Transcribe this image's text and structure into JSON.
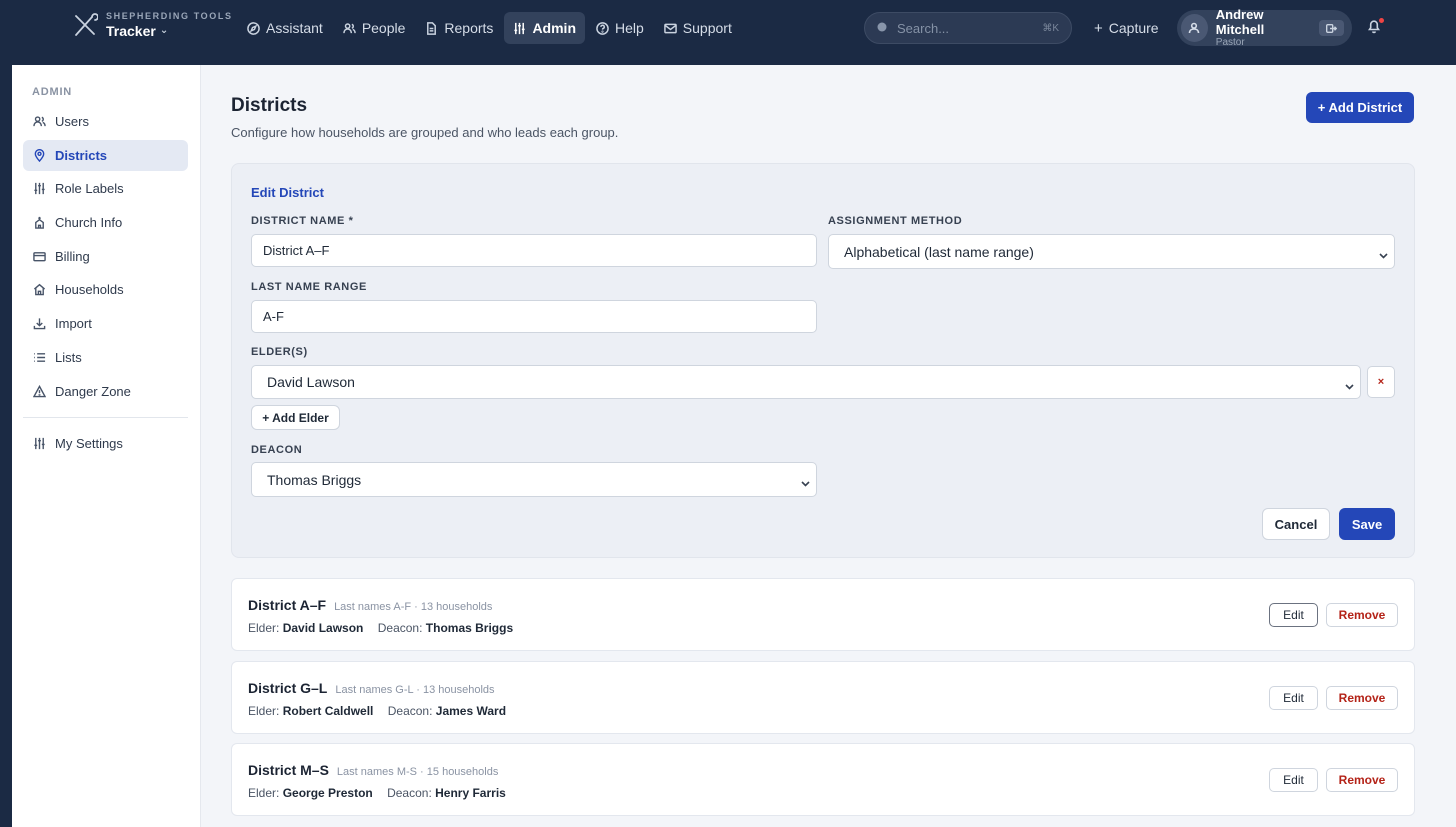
{
  "app": {
    "kicker": "SHEPHERDING TOOLS",
    "name": "Tracker"
  },
  "nav": [
    {
      "label": "Assistant",
      "icon": "compass-icon"
    },
    {
      "label": "People",
      "icon": "people-icon"
    },
    {
      "label": "Reports",
      "icon": "document-icon"
    },
    {
      "label": "Admin",
      "icon": "sliders-icon",
      "active": true
    },
    {
      "label": "Help",
      "icon": "help-circle-icon"
    },
    {
      "label": "Support",
      "icon": "mail-icon"
    }
  ],
  "search": {
    "placeholder": "Search...",
    "shortcut": "⌘K"
  },
  "capture_label": "Capture",
  "user": {
    "name": "Andrew Mitchell",
    "role": "Pastor"
  },
  "sidebar": {
    "heading": "ADMIN",
    "items": [
      {
        "label": "Users",
        "icon": "users-icon"
      },
      {
        "label": "Districts",
        "icon": "map-pin-icon",
        "active": true
      },
      {
        "label": "Role Labels",
        "icon": "sliders-icon"
      },
      {
        "label": "Church Info",
        "icon": "church-icon"
      },
      {
        "label": "Billing",
        "icon": "credit-card-icon"
      },
      {
        "label": "Households",
        "icon": "home-icon"
      },
      {
        "label": "Import",
        "icon": "download-icon"
      },
      {
        "label": "Lists",
        "icon": "list-icon"
      },
      {
        "label": "Danger Zone",
        "icon": "warning-icon"
      }
    ],
    "settings": {
      "label": "My Settings",
      "icon": "sliders-icon"
    }
  },
  "page": {
    "title": "Districts",
    "subtitle": "Configure how households are grouped and who leads each group.",
    "add_button": "+ Add District"
  },
  "edit_form": {
    "title": "Edit District",
    "name_label": "DISTRICT NAME *",
    "name_value": "District A–F",
    "method_label": "ASSIGNMENT METHOD",
    "method_value": "Alphabetical (last name range)",
    "range_label": "LAST NAME RANGE",
    "range_value": "A-F",
    "elders_label": "ELDER(S)",
    "elder_value": "David Lawson",
    "remove_elder": "×",
    "add_elder": "+ Add Elder",
    "deacon_label": "DEACON",
    "deacon_value": "Thomas Briggs",
    "cancel": "Cancel",
    "save": "Save"
  },
  "districts": [
    {
      "name": "District A–F",
      "meta": "Last names A-F · 13 households",
      "elder_label": "Elder:",
      "elder": "David Lawson",
      "deacon_label": "Deacon:",
      "deacon": "Thomas Briggs",
      "edit": "Edit",
      "remove": "Remove"
    },
    {
      "name": "District G–L",
      "meta": "Last names G-L · 13 households",
      "elder_label": "Elder:",
      "elder": "Robert Caldwell",
      "deacon_label": "Deacon:",
      "deacon": "James Ward",
      "edit": "Edit",
      "remove": "Remove"
    },
    {
      "name": "District M–S",
      "meta": "Last names M-S · 15 households",
      "elder_label": "Elder:",
      "elder": "George Preston",
      "deacon_label": "Deacon:",
      "deacon": "Henry Farris",
      "edit": "Edit",
      "remove": "Remove"
    }
  ],
  "colors": {
    "navy": "#1b2a44",
    "accent": "#2447b8",
    "danger": "#b42318"
  }
}
